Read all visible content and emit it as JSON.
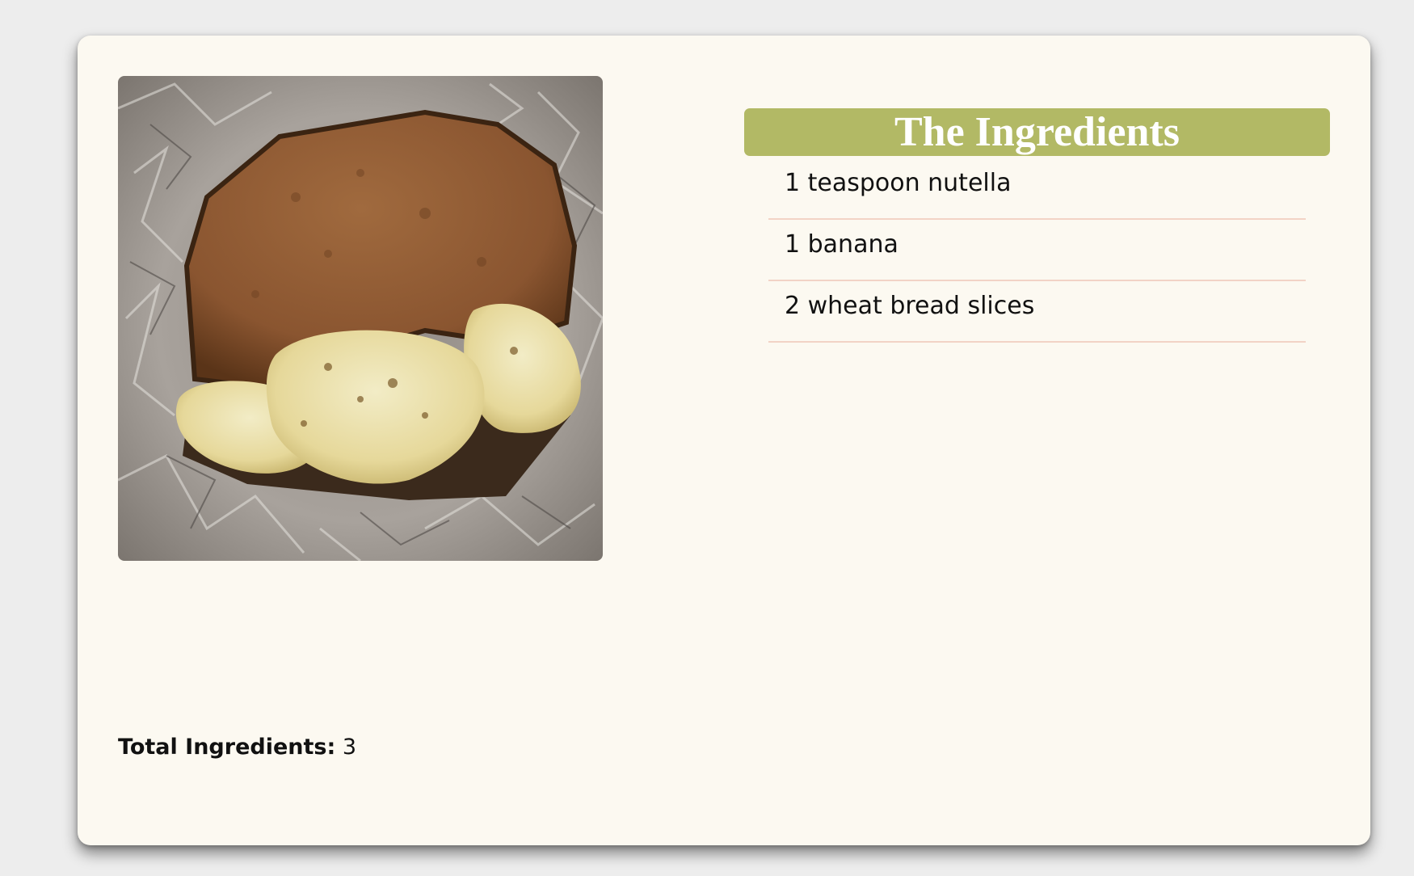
{
  "recipe": {
    "ingredients_heading": "The Ingredients",
    "ingredients": [
      "1 teaspoon nutella",
      "1 banana",
      "2 wheat bread slices"
    ],
    "total_label": "Total Ingredients:",
    "total_value": "3"
  },
  "colors": {
    "page_background": "#ededed",
    "card_background": "#fcf9f1",
    "heading_background": "#b2b965",
    "divider": "#f2d3c6"
  },
  "image": {
    "subject": "nutella banana sandwich on crumpled aluminum foil"
  }
}
